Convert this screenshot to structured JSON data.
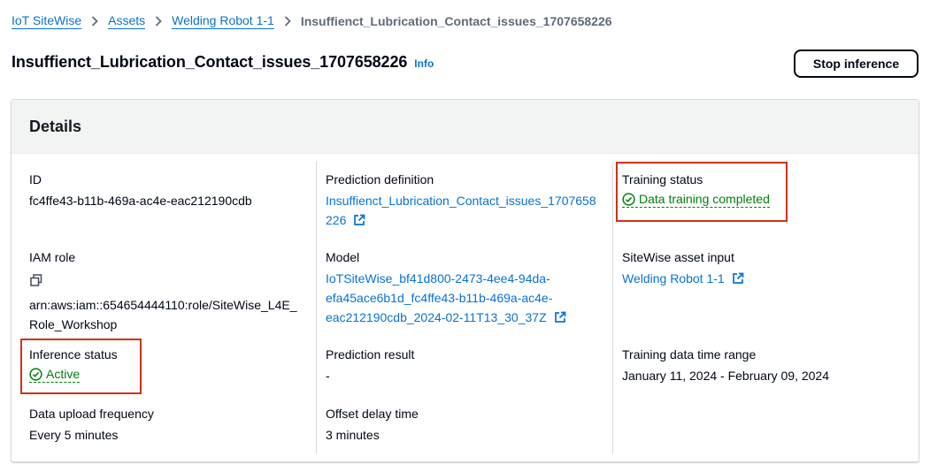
{
  "breadcrumb": {
    "items": [
      "IoT SiteWise",
      "Assets",
      "Welding Robot 1-1"
    ],
    "current": "Insuffienct_Lubrication_Contact_issues_1707658226"
  },
  "header": {
    "title": "Insuffienct_Lubrication_Contact_issues_1707658226",
    "info": "Info",
    "stop_button": "Stop inference"
  },
  "details": {
    "title": "Details",
    "id": {
      "label": "ID",
      "value": "fc4ffe43-b11b-469a-ac4e-eac212190cdb"
    },
    "iam_role": {
      "label": "IAM role",
      "value_line1": "arn:aws:iam::654654444110:role/SiteWise_L4E_",
      "value_line2": "Role_Workshop"
    },
    "inference_status": {
      "label": "Inference status",
      "value": "Active"
    },
    "data_upload_frequency": {
      "label": "Data upload frequency",
      "value": "Every 5 minutes"
    },
    "prediction_definition": {
      "label": "Prediction definition",
      "value_line1": "Insuffienct_Lubrication_Contact_issues_1707658",
      "value_line2": "226"
    },
    "model": {
      "label": "Model",
      "value_line1": "IoTSiteWise_bf41d800-2473-4ee4-94da-",
      "value_line2": "efa45ace6b1d_fc4ffe43-b11b-469a-ac4e-",
      "value_line3": "eac212190cdb_2024-02-11T13_30_37Z"
    },
    "prediction_result": {
      "label": "Prediction result",
      "value": "-"
    },
    "offset_delay_time": {
      "label": "Offset delay time",
      "value": "3 minutes"
    },
    "training_status": {
      "label": "Training status",
      "value": "Data training completed"
    },
    "sitewise_asset_input": {
      "label": "SiteWise asset input",
      "value": "Welding Robot 1-1"
    },
    "training_data_time_range": {
      "label": "Training data time range",
      "value": "January 11, 2024 - February 09, 2024"
    }
  },
  "colors": {
    "link": "#0972d3",
    "success": "#037f0c",
    "highlight": "#d13212",
    "header_bg": "#f2f3f3"
  }
}
